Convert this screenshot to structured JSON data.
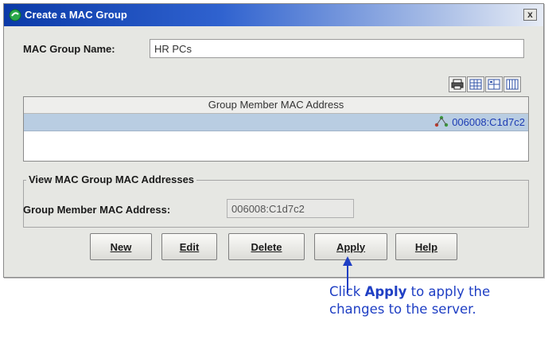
{
  "window": {
    "title": "Create a MAC Group",
    "close_glyph": "x"
  },
  "form": {
    "group_name_label": "MAC Group Name:",
    "group_name_value": "HR PCs"
  },
  "toolbar_icons": [
    "print-icon",
    "table-view-icon",
    "grid-view-icon",
    "column-view-icon"
  ],
  "table": {
    "column_header": "Group Member MAC Address",
    "rows": [
      "006008:C1d7c2"
    ]
  },
  "view_section": {
    "title": "View MAC Group MAC Addresses",
    "field_label": "Group Member MAC Address:",
    "field_value": "006008:C1d7c2"
  },
  "buttons": {
    "new": "New",
    "edit": "Edit",
    "delete": "Delete",
    "apply": "Apply",
    "help": "Help"
  },
  "annotation": {
    "line1_prefix": "Click ",
    "line1_bold": "Apply",
    "line1_suffix": " to apply the",
    "line2": "changes to the server."
  },
  "colors": {
    "title_bar": "#0b3aa8",
    "dialog_bg": "#e6e7e3",
    "selected_row": "#b9cde2",
    "link_text": "#1d3cb3",
    "annotation_text": "#1f3fc4"
  }
}
